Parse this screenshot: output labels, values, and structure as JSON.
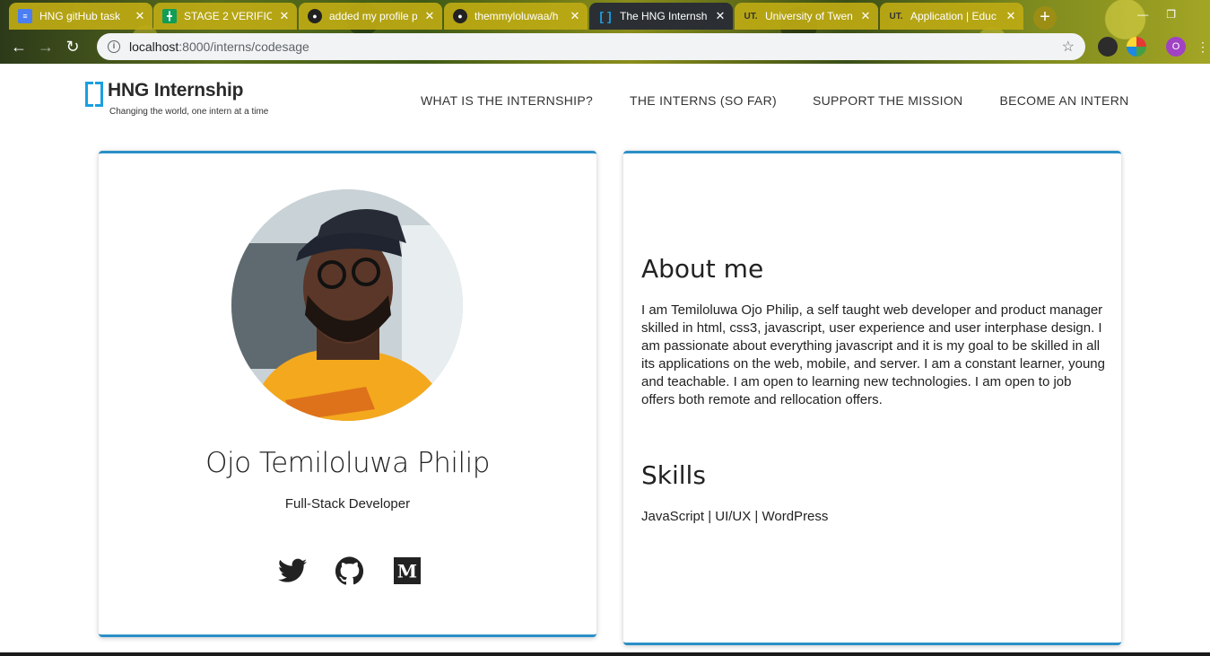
{
  "browser": {
    "tabs": [
      {
        "title": "HNG gitHub task",
        "icon": "google-docs-icon",
        "active": false
      },
      {
        "title": "STAGE 2 VERIFICA",
        "icon": "google-sheets-icon",
        "active": false
      },
      {
        "title": "added my profile p",
        "icon": "github-icon",
        "active": false
      },
      {
        "title": "themmyloluwaa/h",
        "icon": "github-icon",
        "active": false
      },
      {
        "title": "The HNG Internsh",
        "icon": "hng-icon",
        "active": true
      },
      {
        "title": "University of Twen",
        "icon": "ut-icon",
        "active": false
      },
      {
        "title": "Application | Educ",
        "icon": "ut-icon",
        "active": false
      }
    ],
    "url_host": "localhost",
    "url_path": ":8000/interns/codesage",
    "profile_initial": "O"
  },
  "site": {
    "logo_name": "HNG Internship",
    "logo_tagline": "Changing the world, one intern at a time",
    "nav": [
      "WHAT IS THE INTERNSHIP?",
      "THE INTERNS (SO FAR)",
      "SUPPORT THE MISSION",
      "BECOME AN INTERN"
    ],
    "accent_color": "#2b8fc7"
  },
  "profile": {
    "name": "Ojo Temiloluwa Philip",
    "role": "Full-Stack Developer",
    "socials": [
      "twitter-icon",
      "github-icon",
      "medium-icon"
    ]
  },
  "about": {
    "title": "About me",
    "text": "I am Temiloluwa Ojo Philip, a self taught web developer and product manager skilled in html, css3, javascript, user experience and user interphase design. I am passionate about everything javascript and it is my goal to be skilled in all its applications on the web, mobile, and server. I am a constant learner, young and teachable. I am open to learning new technologies. I am open to job offers both remote and rellocation offers.",
    "skills_title": "Skills",
    "skills_text": "JavaScript | UI/UX | WordPress"
  }
}
